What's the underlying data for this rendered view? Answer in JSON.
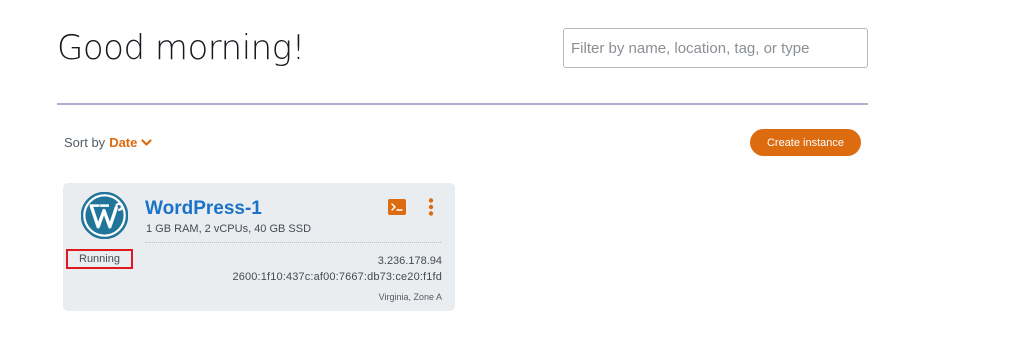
{
  "header": {
    "greeting": "Good morning!"
  },
  "search": {
    "value": "",
    "placeholder": "Filter by name, location, tag, or type"
  },
  "toolbar": {
    "sort_label": "Sort by",
    "sort_value": "Date",
    "create_label": "Create instance"
  },
  "instances": [
    {
      "name": "WordPress-1",
      "spec": "1 GB RAM, 2 vCPUs, 40 GB SSD",
      "status": "Running",
      "ipv4": "3.236.178.94",
      "ipv6": "2600:1f10:437c:af00:7667:db73:ce20:f1fd",
      "location": "Virginia, Zone A",
      "blueprint_icon": "wordpress-logo-icon"
    }
  ],
  "icons": {
    "sort": "chevron-down-icon",
    "connect": "terminal-icon",
    "menu": "kebab-menu-icon"
  },
  "colors": {
    "accent": "#dd6b10",
    "link": "#1a73c8",
    "status_highlight": "#e0191f",
    "card_bg": "#eaedef",
    "divider": "#b6aecf"
  }
}
